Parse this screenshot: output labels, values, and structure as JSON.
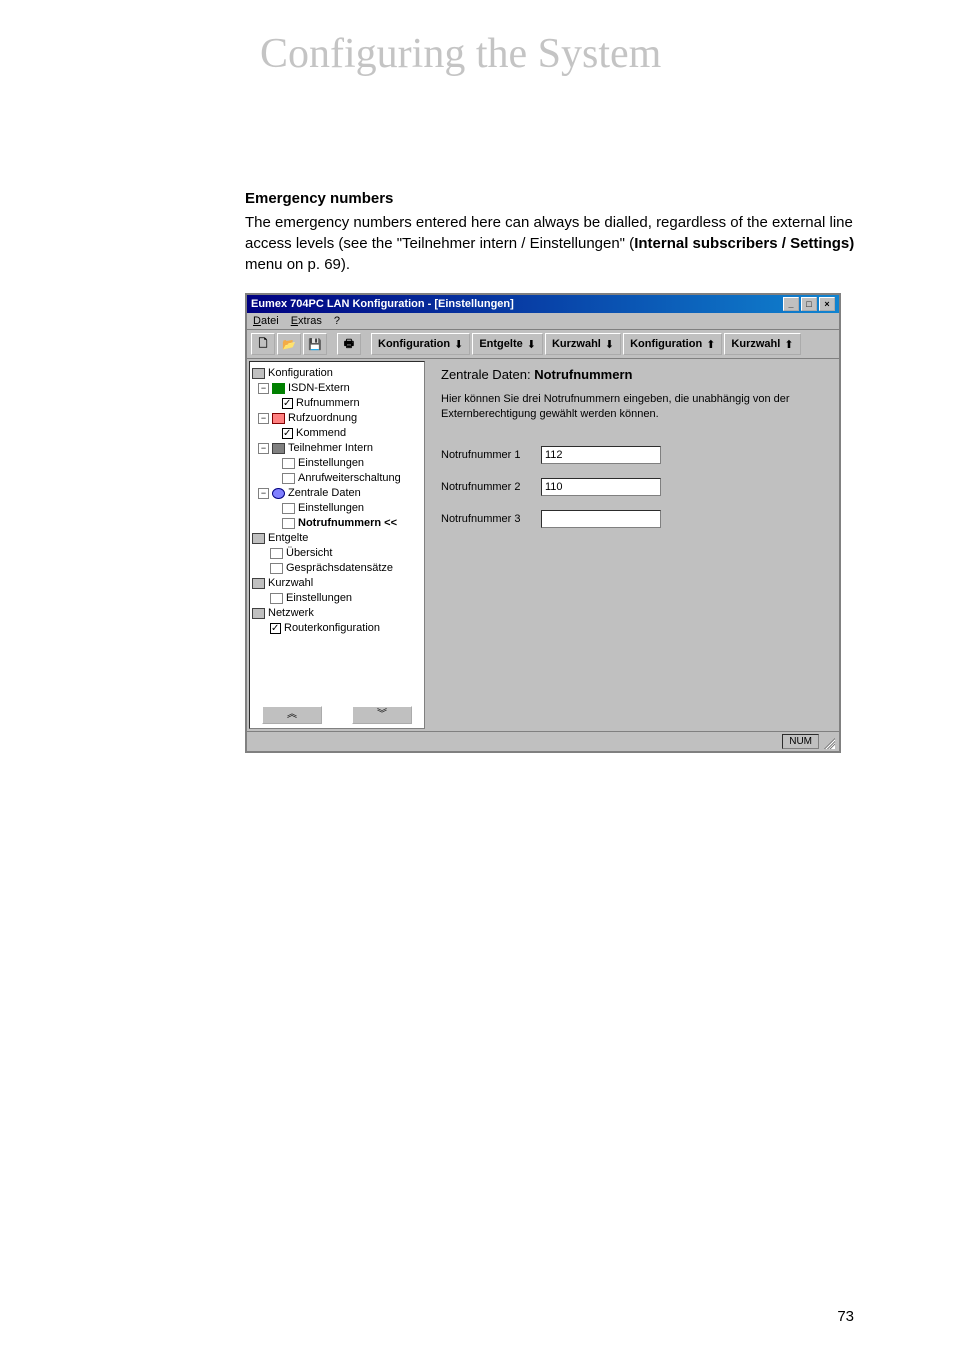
{
  "chapter_title": "Configuring the System",
  "section_heading": "Emergency numbers",
  "body_text_1": "The emergency numbers entered here can always be dialled, regardless of the external line access levels (see the \"Teilnehmer intern / Einstellungen\" (",
  "body_text_bold": "Internal subscribers / Settings)",
  "body_text_2": " menu on p. 69).",
  "window": {
    "title": "Eumex 704PC LAN Konfiguration - [Einstellungen]",
    "menu": {
      "datei": "Datei",
      "extras": "Extras",
      "help": "?"
    },
    "toolbar": {
      "konfig1": "Konfiguration",
      "entgelte": "Entgelte",
      "kurzwahl1": "Kurzwahl",
      "konfig2": "Konfiguration",
      "kurzwahl2": "Kurzwahl"
    },
    "tree": {
      "root": "Konfiguration",
      "isdn": "ISDN-Extern",
      "rufnummern": "Rufnummern",
      "rufzuord": "Rufzuordnung",
      "kommend": "Kommend",
      "teilnehmer": "Teilnehmer Intern",
      "einstell1": "Einstellungen",
      "anrufw": "Anrufweiterschaltung",
      "zentrale": "Zentrale Daten",
      "einstell2": "Einstellungen",
      "notruf": "Notrufnummern <<",
      "entgelte": "Entgelte",
      "uebersicht": "Übersicht",
      "gespr": "Gesprächsdatensätze",
      "kurzwahl": "Kurzwahl",
      "einstell3": "Einstellungen",
      "netzwerk": "Netzwerk",
      "router": "Routerkonfiguration"
    },
    "panel": {
      "title_prefix": "Zentrale Daten:",
      "title_bold": " Notrufnummern",
      "desc": "Hier können Sie drei Notrufnummern eingeben, die unabhängig von der Externberechtigung gewählt werden können.",
      "label1": "Notrufnummer 1",
      "value1": "112",
      "label2": "Notrufnummer 2",
      "value2": "110",
      "label3": "Notrufnummer 3",
      "value3": ""
    },
    "status": {
      "num": "NUM"
    }
  },
  "page_number": "73"
}
